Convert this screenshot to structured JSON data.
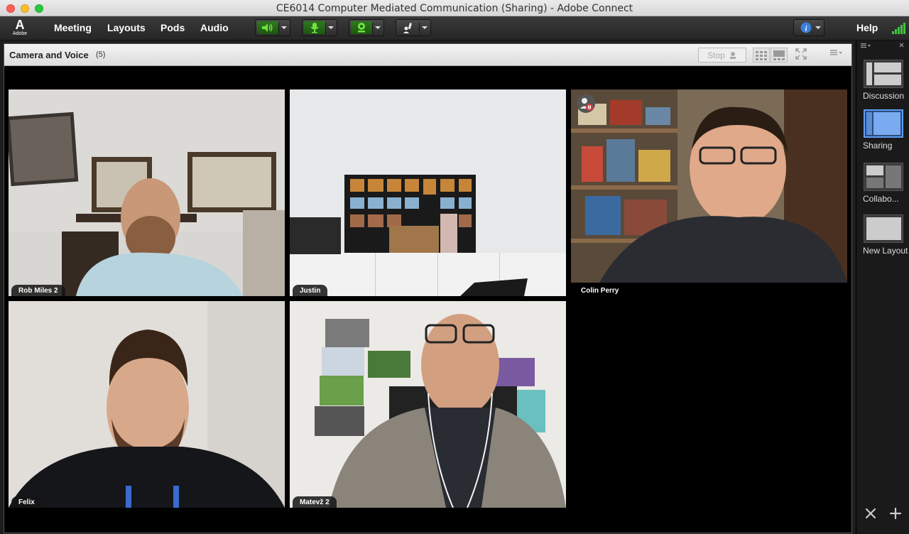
{
  "window": {
    "title": "CE6014 Computer Mediated Communication (Sharing) - Adobe Connect"
  },
  "brand": {
    "logo_text": "Adobe",
    "logo_glyph": "A"
  },
  "menu": [
    {
      "label": "Meeting"
    },
    {
      "label": "Layouts"
    },
    {
      "label": "Pods"
    },
    {
      "label": "Audio"
    }
  ],
  "toolbar": {
    "speaker_icon": "speaker-icon",
    "mic_icon": "microphone-icon",
    "camera_icon": "webcam-icon",
    "raise_hand_icon": "raise-hand-icon",
    "info_icon": "info-icon",
    "accent_green": "#4cd94c"
  },
  "help_label": "Help",
  "pod": {
    "title": "Camera and Voice",
    "count": "(5)",
    "stop_label": "Stop"
  },
  "participants": [
    {
      "name": "Rob Miles 2"
    },
    {
      "name": "Justin"
    },
    {
      "name": "Colin Perry"
    },
    {
      "name": "Felix"
    },
    {
      "name": "Matevž 2"
    }
  ],
  "layouts": [
    {
      "label": "Discussion",
      "selected": false
    },
    {
      "label": "Sharing",
      "selected": true
    },
    {
      "label": "Collabo...",
      "selected": false
    },
    {
      "label": "New Layout",
      "selected": false
    }
  ]
}
